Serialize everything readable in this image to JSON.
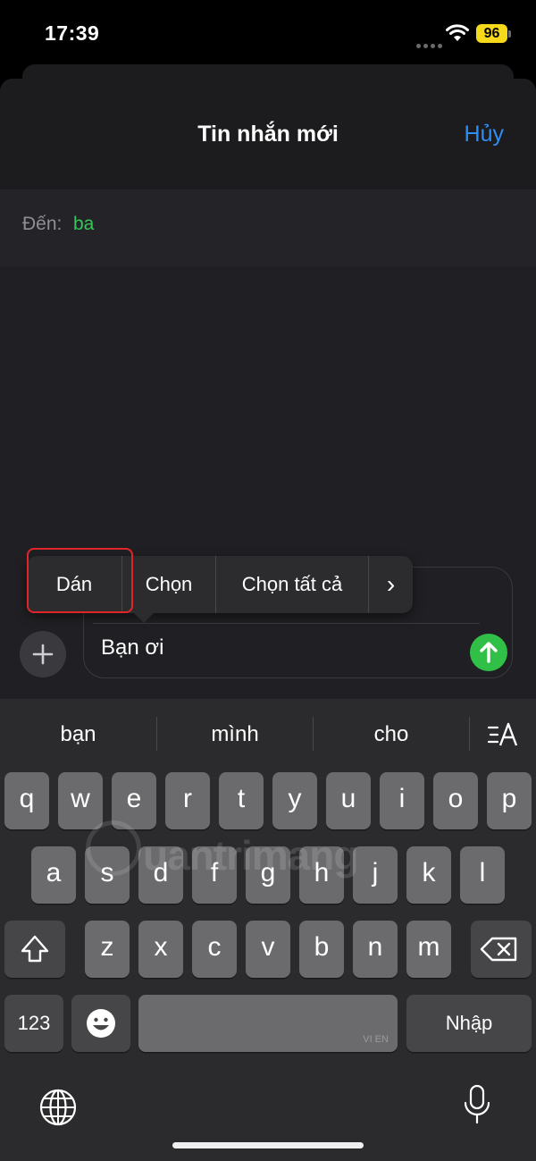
{
  "status": {
    "time": "17:39",
    "battery": "96"
  },
  "header": {
    "title": "Tin nhắn mới",
    "cancel": "Hủy"
  },
  "recipient": {
    "label": "Đến:",
    "value": "ba"
  },
  "composer": {
    "text": "Bạn ơi"
  },
  "edit_menu": {
    "paste": "Dán",
    "select": "Chọn",
    "select_all": "Chọn tất cả",
    "more": "›"
  },
  "suggestions": [
    "bạn",
    "mình",
    "cho"
  ],
  "keyboard": {
    "row1": [
      "q",
      "w",
      "e",
      "r",
      "t",
      "y",
      "u",
      "i",
      "o",
      "p"
    ],
    "row2": [
      "a",
      "s",
      "d",
      "f",
      "g",
      "h",
      "j",
      "k",
      "l"
    ],
    "row3": [
      "z",
      "x",
      "c",
      "v",
      "b",
      "n",
      "m"
    ],
    "numbers_key": "123",
    "return_key": "Nhập",
    "space_hint": "VI EN"
  },
  "watermark": "uantrimang",
  "colors": {
    "accent": "#2e8ef5",
    "recipient": "#34c759",
    "send": "#30c048",
    "highlight": "#e0252b"
  }
}
